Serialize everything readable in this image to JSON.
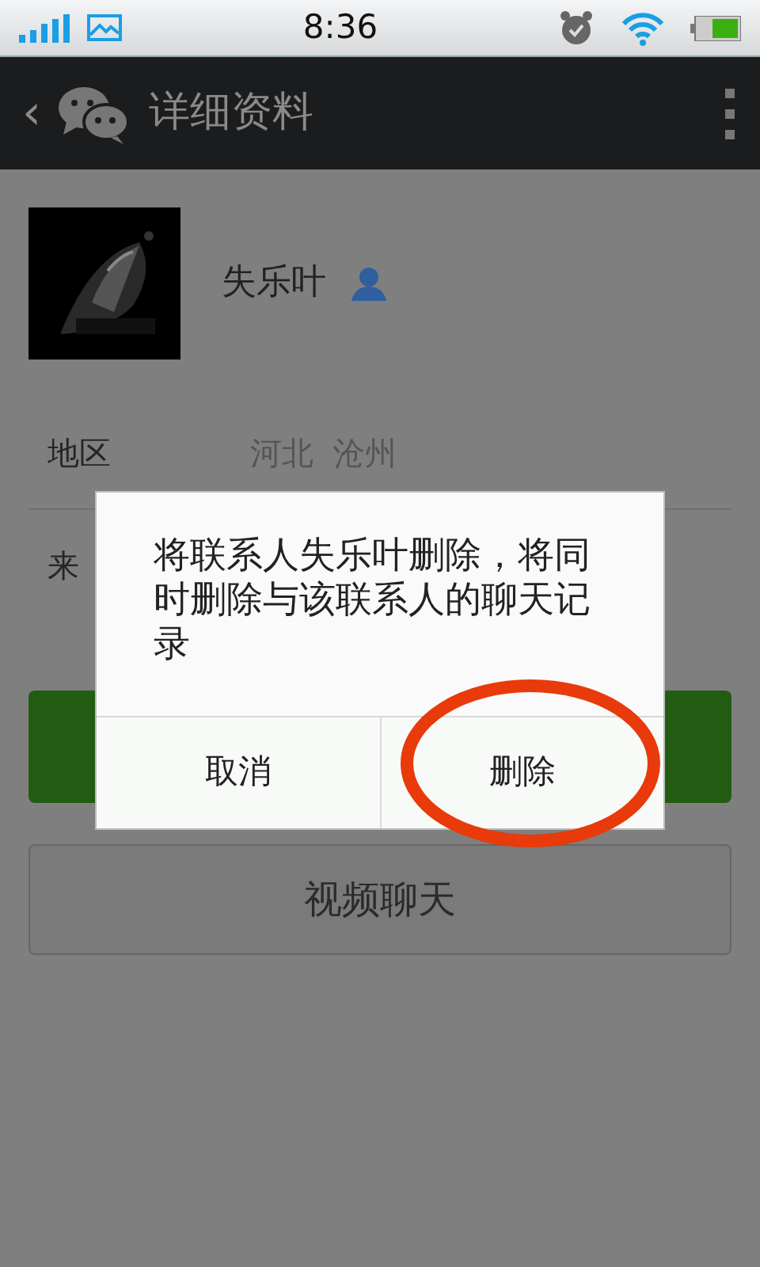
{
  "status_bar": {
    "time": "8:36"
  },
  "app_bar": {
    "back": "‹",
    "title": "详细资料"
  },
  "profile": {
    "name": "失乐叶"
  },
  "info_rows": [
    {
      "label": "地区",
      "value": "河北  沧州"
    },
    {
      "label": "来"
    }
  ],
  "buttons": [
    {
      "kind": "primary"
    },
    {
      "kind": "secondary",
      "label": "视频聊天"
    }
  ],
  "dialog": {
    "message": "将联系人失乐叶删除，将同时删除与该联系人的聊天记录",
    "buttons": [
      {
        "label": "取消"
      },
      {
        "label": "删除"
      }
    ]
  },
  "annotation": {
    "kind": "ellipse",
    "color": "#e83a0a"
  }
}
